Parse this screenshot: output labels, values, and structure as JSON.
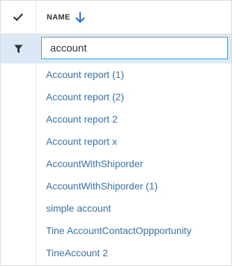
{
  "header": {
    "select_all_icon": "checkmark-icon",
    "column_title": "NAME",
    "sort_icon": "arrow-down-icon",
    "sort_direction": "descending"
  },
  "filter": {
    "icon": "funnel-filter-icon",
    "value": "account"
  },
  "items": [
    "Account report (1)",
    "Account report (2)",
    "Account report 2",
    "Account report x",
    "AccountWithShiporder",
    "AccountWithShiporder (1)",
    "simple account",
    "Tine AccountContactOppportunity",
    "TineAccount 2"
  ],
  "colors": {
    "link": "#2f73c5",
    "filter_row_bg": "#dbe9f7",
    "input_border": "#4c9be8",
    "sort_arrow": "#1a73e8"
  }
}
